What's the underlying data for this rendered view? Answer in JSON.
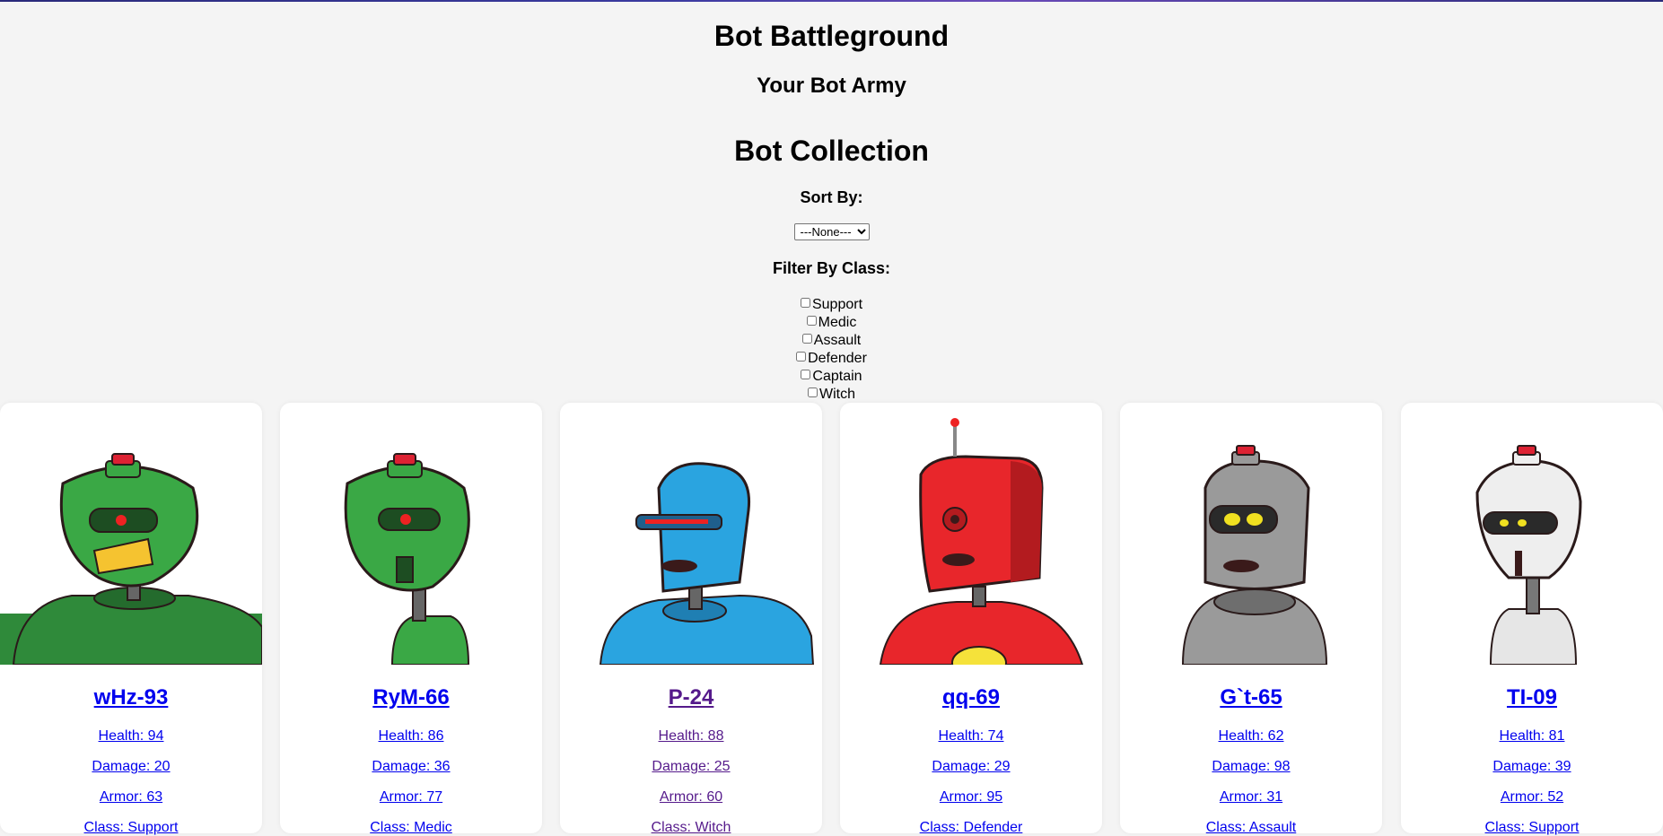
{
  "header": {
    "title": "Bot Battleground",
    "army_title": "Your Bot Army"
  },
  "collection": {
    "title": "Bot Collection",
    "sort_label": "Sort By:",
    "sort_selected": "---None---",
    "filter_label": "Filter By Class:",
    "filters": [
      "Support",
      "Medic",
      "Assault",
      "Defender",
      "Captain",
      "Witch"
    ]
  },
  "bots": [
    {
      "name": "wHz-93",
      "health": "Health: 94",
      "damage": "Damage: 20",
      "armor": "Armor: 63",
      "class": "Class: Support",
      "color": "#3aa845",
      "icon": "green-robot-image"
    },
    {
      "name": "RyM-66",
      "health": "Health: 86",
      "damage": "Damage: 36",
      "armor": "Armor: 77",
      "class": "Class: Medic",
      "color": "#3aa845",
      "icon": "green-robot-image"
    },
    {
      "name": "P-24",
      "health": "Health: 88",
      "damage": "Damage: 25",
      "armor": "Armor: 60",
      "class": "Class: Witch",
      "color": "#2aa4e0",
      "icon": "blue-robot-image"
    },
    {
      "name": "qq-69",
      "health": "Health: 74",
      "damage": "Damage: 29",
      "armor": "Armor: 95",
      "class": "Class: Defender",
      "color": "#e8262b",
      "icon": "red-robot-image"
    },
    {
      "name": "G`t-65",
      "health": "Health: 62",
      "damage": "Damage: 98",
      "armor": "Armor: 31",
      "class": "Class: Assault",
      "color": "#9a9a9a",
      "icon": "gray-robot-image"
    },
    {
      "name": "TI-09",
      "health": "Health: 81",
      "damage": "Damage: 39",
      "armor": "Armor: 52",
      "class": "Class: Support",
      "color": "#e6e6e6",
      "icon": "white-robot-image"
    }
  ]
}
